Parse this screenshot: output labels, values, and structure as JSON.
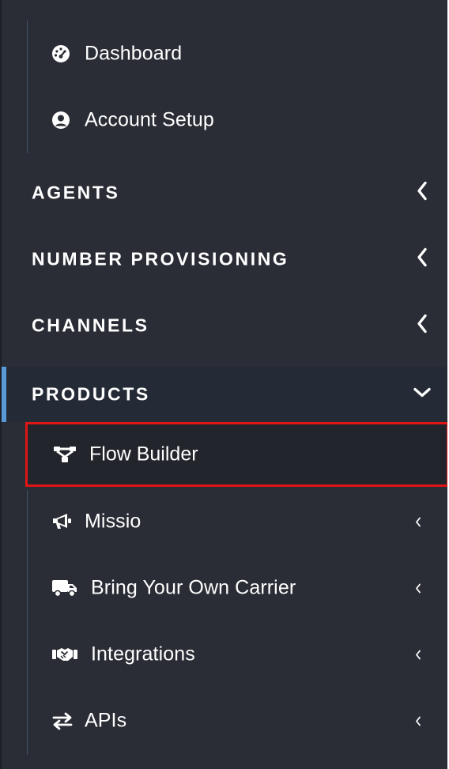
{
  "top_items": [
    {
      "label": "Dashboard",
      "icon": "speedometer-icon"
    },
    {
      "label": "Account Setup",
      "icon": "user-circle-icon"
    }
  ],
  "sections": [
    {
      "title": "AGENTS",
      "state": "collapsed"
    },
    {
      "title": "NUMBER PROVISIONING",
      "state": "collapsed"
    },
    {
      "title": "CHANNELS",
      "state": "collapsed"
    },
    {
      "title": "PRODUCTS",
      "state": "expanded"
    }
  ],
  "products_items": [
    {
      "label": "Flow Builder",
      "icon": "sitemap-icon",
      "selected": true
    },
    {
      "label": "Missio",
      "icon": "megaphone-icon"
    },
    {
      "label": "Bring Your Own Carrier",
      "icon": "truck-icon"
    },
    {
      "label": "Integrations",
      "icon": "handshake-icon"
    },
    {
      "label": "APIs",
      "icon": "exchange-arrows-icon"
    }
  ],
  "colors": {
    "background": "#2a2d35",
    "active_section": "#242b36",
    "accent": "#5a9ad8",
    "highlight_border": "#e01515"
  }
}
